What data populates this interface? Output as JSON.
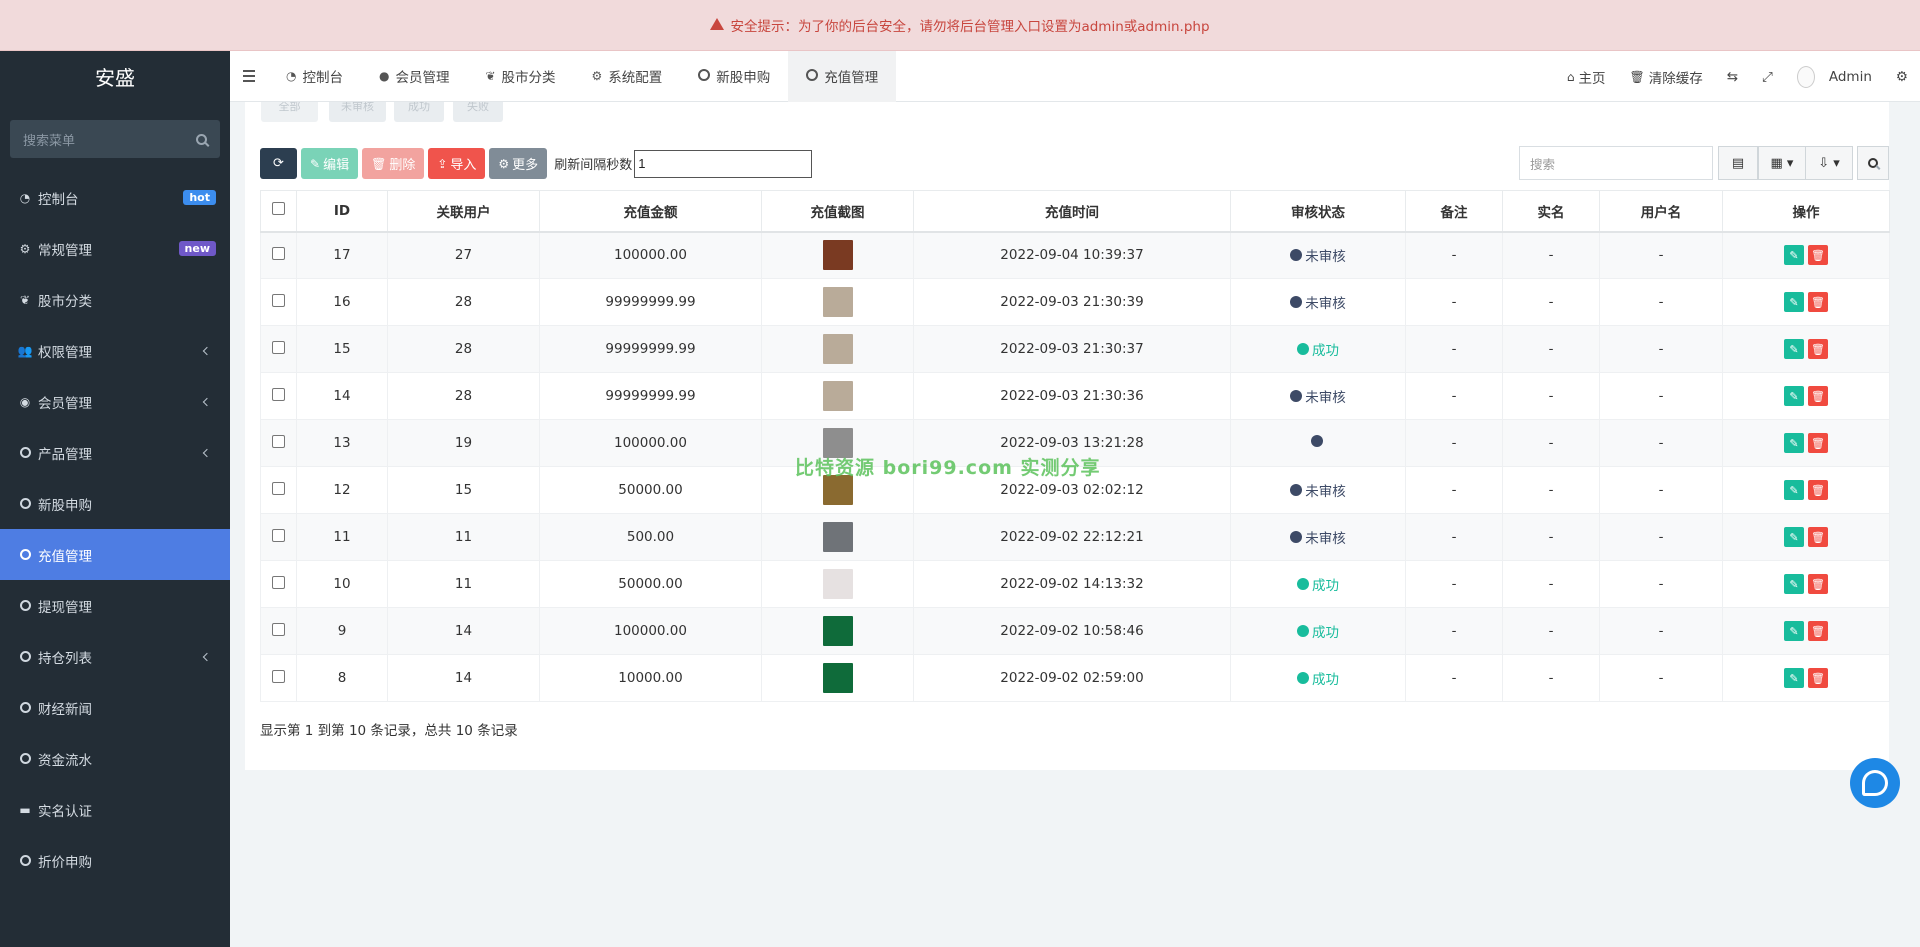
{
  "alert": {
    "icon": "warning-icon",
    "text": "安全提示：为了你的后台安全，请勿将后台管理入口设置为admin或admin.php"
  },
  "sidebar": {
    "logo": "安盛",
    "search_placeholder": "搜索菜单",
    "items": [
      {
        "label": "控制台",
        "icon": "dashboard-icon",
        "badge": "hot"
      },
      {
        "label": "常规管理",
        "icon": "cogs-icon",
        "badge": "new"
      },
      {
        "label": "股市分类",
        "icon": "leaf-icon"
      },
      {
        "label": "权限管理",
        "icon": "users-icon",
        "submenu": true
      },
      {
        "label": "会员管理",
        "icon": "user-circle-icon",
        "submenu": true
      },
      {
        "label": "产品管理",
        "icon": "circle-icon",
        "submenu": true
      },
      {
        "label": "新股申购",
        "icon": "circle-icon"
      },
      {
        "label": "充值管理",
        "icon": "circle-icon",
        "active": true
      },
      {
        "label": "提现管理",
        "icon": "circle-icon"
      },
      {
        "label": "持仓列表",
        "icon": "circle-icon",
        "submenu": true
      },
      {
        "label": "财经新闻",
        "icon": "circle-icon"
      },
      {
        "label": "资金流水",
        "icon": "circle-icon"
      },
      {
        "label": "实名认证",
        "icon": "credit-card-icon"
      },
      {
        "label": "折价申购",
        "icon": "circle-icon"
      }
    ]
  },
  "topbar": {
    "tabs": [
      {
        "label": "控制台",
        "icon": "dashboard-icon"
      },
      {
        "label": "会员管理",
        "icon": "user-icon"
      },
      {
        "label": "股市分类",
        "icon": "leaf-icon"
      },
      {
        "label": "系统配置",
        "icon": "gear-icon"
      },
      {
        "label": "新股申购",
        "icon": "circle-icon"
      },
      {
        "label": "充值管理",
        "icon": "circle-icon",
        "active": true
      }
    ],
    "right": {
      "home": "主页",
      "clear_cache": "清除缓存",
      "user": "Admin"
    }
  },
  "subtabs": [
    "全部",
    "未审核",
    "成功",
    "失败"
  ],
  "toolbar": {
    "edit": "编辑",
    "delete": "删除",
    "import": "导入",
    "more": "更多",
    "interval_label": "刷新间隔秒数",
    "interval_value": "1",
    "search_placeholder": "搜索"
  },
  "table": {
    "columns": [
      "ID",
      "关联用户",
      "充值金额",
      "充值截图",
      "充值时间",
      "审核状态",
      "备注",
      "实名",
      "用户名",
      "操作"
    ],
    "rows": [
      {
        "id": "17",
        "user": "27",
        "amount": "100000.00",
        "shot": "#7a3a22",
        "time": "2022-09-04 10:39:37",
        "status": "未审核",
        "status_color": "#3d4a66",
        "note": "-",
        "realname": "-",
        "username": "-"
      },
      {
        "id": "16",
        "user": "28",
        "amount": "99999999.99",
        "shot": "#b9ab99",
        "time": "2022-09-03 21:30:39",
        "status": "未审核",
        "status_color": "#3d4a66",
        "note": "-",
        "realname": "-",
        "username": "-"
      },
      {
        "id": "15",
        "user": "28",
        "amount": "99999999.99",
        "shot": "#b9ab99",
        "time": "2022-09-03 21:30:37",
        "status": "成功",
        "status_color": "#18bc9c",
        "note": "-",
        "realname": "-",
        "username": "-"
      },
      {
        "id": "14",
        "user": "28",
        "amount": "99999999.99",
        "shot": "#b9ab99",
        "time": "2022-09-03 21:30:36",
        "status": "未审核",
        "status_color": "#3d4a66",
        "note": "-",
        "realname": "-",
        "username": "-"
      },
      {
        "id": "13",
        "user": "19",
        "amount": "100000.00",
        "shot": "#8e8e8e",
        "time": "2022-09-03 13:21:28",
        "status": "",
        "status_color": "#3d4a66",
        "note": "-",
        "realname": "-",
        "username": "-"
      },
      {
        "id": "12",
        "user": "15",
        "amount": "50000.00",
        "shot": "#8a6a30",
        "time": "2022-09-03 02:02:12",
        "status": "未审核",
        "status_color": "#3d4a66",
        "note": "-",
        "realname": "-",
        "username": "-"
      },
      {
        "id": "11",
        "user": "11",
        "amount": "500.00",
        "shot": "#6f7378",
        "time": "2022-09-02 22:12:21",
        "status": "未审核",
        "status_color": "#3d4a66",
        "note": "-",
        "realname": "-",
        "username": "-"
      },
      {
        "id": "10",
        "user": "11",
        "amount": "50000.00",
        "shot": "#e6e1e1",
        "time": "2022-09-02 14:13:32",
        "status": "成功",
        "status_color": "#18bc9c",
        "note": "-",
        "realname": "-",
        "username": "-"
      },
      {
        "id": "9",
        "user": "14",
        "amount": "100000.00",
        "shot": "#0f6b3a",
        "time": "2022-09-02 10:58:46",
        "status": "成功",
        "status_color": "#18bc9c",
        "note": "-",
        "realname": "-",
        "username": "-"
      },
      {
        "id": "8",
        "user": "14",
        "amount": "10000.00",
        "shot": "#0f6b3a",
        "time": "2022-09-02 02:59:00",
        "status": "成功",
        "status_color": "#18bc9c",
        "note": "-",
        "realname": "-",
        "username": "-"
      }
    ]
  },
  "pagination": {
    "info": "显示第 1 到第 10 条记录，总共 10 条记录"
  },
  "watermark": "比特资源 bori99.com 实测分享"
}
